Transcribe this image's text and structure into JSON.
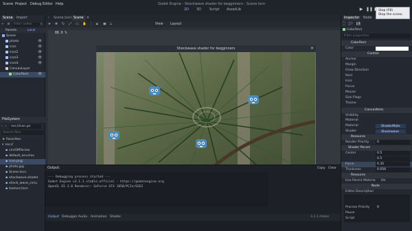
{
  "window": {
    "title": "Godot Engine - Shockwave shader for begginners - Scene.tscn"
  },
  "menu": [
    "Scene",
    "Project",
    "Debug",
    "Editor",
    "Help"
  ],
  "workspaces": [
    "2D",
    "3D",
    "Script",
    "AssetLib"
  ],
  "tooltip": {
    "line1": "Stop (F8)",
    "line2": "Stop the scene."
  },
  "scene_tabs": {
    "left": "Scene",
    "right": "Import",
    "open_tab": "Scene"
  },
  "scene_filter_placeholder": "Filter nodes",
  "scene_tree_header": {
    "parents": "Parents",
    "local": "Local"
  },
  "scene_tree": [
    {
      "label": "Scene",
      "indent": 0,
      "color": "#8fb3f0",
      "eye": false
    },
    {
      "label": "photo",
      "indent": 1,
      "color": "#a8c7ff",
      "eye": true
    },
    {
      "label": "icon",
      "indent": 1,
      "color": "#a8c7ff",
      "eye": true
    },
    {
      "label": "icon2",
      "indent": 1,
      "color": "#a8c7ff",
      "eye": true
    },
    {
      "label": "icon3",
      "indent": 1,
      "color": "#a8c7ff",
      "eye": true
    },
    {
      "label": "icon4",
      "indent": 1,
      "color": "#a8c7ff",
      "eye": true
    },
    {
      "label": "CanvasLayer",
      "indent": 1,
      "color": "#d0d0d0",
      "eye": false
    },
    {
      "label": "ColorRect",
      "indent": 2,
      "color": "#8ee08e",
      "eye": true,
      "selected": true
    }
  ],
  "filesystem": {
    "title": "FileSystem",
    "path": "res://icon.pn",
    "search_placeholder": "Search files",
    "favorites": "Favorites:",
    "root": "res://",
    "files": [
      "circlOffile.tex",
      "default_env.tres",
      "icon.png",
      "photo.jpg",
      "Scene.tscn",
      "shockwave.shader",
      "shock_wave_circu",
      "texture.tscn"
    ]
  },
  "editor": {
    "tabs": [
      "Scene.tscn",
      "Scene"
    ],
    "zoom": "88.9 %",
    "view_labels": [
      "View",
      "Layout"
    ],
    "game_window_title": "Shockwave shader for begginners"
  },
  "output": {
    "label": "Output:",
    "copy": "Copy",
    "clear": "Clear",
    "lines": [
      "--- Debugging process started ---",
      "Godot Engine v3.1.1.stable.official - https://godotengine.org",
      "OpenGL ES 3.0 Renderer: GeForce GTX 1050/PCIe/SSE2"
    ]
  },
  "bottom_tabs": [
    "Output",
    "Debugger",
    "Audio",
    "Animation",
    "Shader"
  ],
  "version": "3.1.1.stable",
  "inspector": {
    "tabs": [
      "Inspector",
      "Node"
    ],
    "node_name": "ColorRect",
    "filter_placeholder": "Filter properties",
    "color_label": "Color",
    "sections": {
      "colorrect": "ColorRect",
      "control": "Control",
      "canvasitem": "CanvasItem",
      "resource": "Resource",
      "shader_param": "Shader Param",
      "resource2": "Resource",
      "node": "Node"
    },
    "control_props": [
      "Anchor",
      "Margin",
      "Grow Direction",
      "Rect",
      "Hint",
      "Focus",
      "Mouse",
      "Size Flags",
      "Theme"
    ],
    "canvas_props": [
      "Visibility",
      "Material"
    ],
    "material": {
      "label": "Material",
      "value": "ShaderMate"
    },
    "shader": {
      "label": "Shader",
      "value": "Shockwave"
    },
    "render_priority": {
      "label": "Render Priority",
      "value": "0"
    },
    "center": {
      "label": "Center",
      "x": "0.5",
      "y": "0.5"
    },
    "force": {
      "label": "Force",
      "value": "0.35"
    },
    "thickness": {
      "label": "Thickness",
      "value": "0.056"
    },
    "use_parent_material": {
      "label": "Use Parent Materia",
      "value": "On"
    },
    "editor_description": "Editor Description",
    "process_priority": {
      "label": "Process Priority",
      "value": "0"
    },
    "pause": "Pause",
    "script": "Script"
  }
}
